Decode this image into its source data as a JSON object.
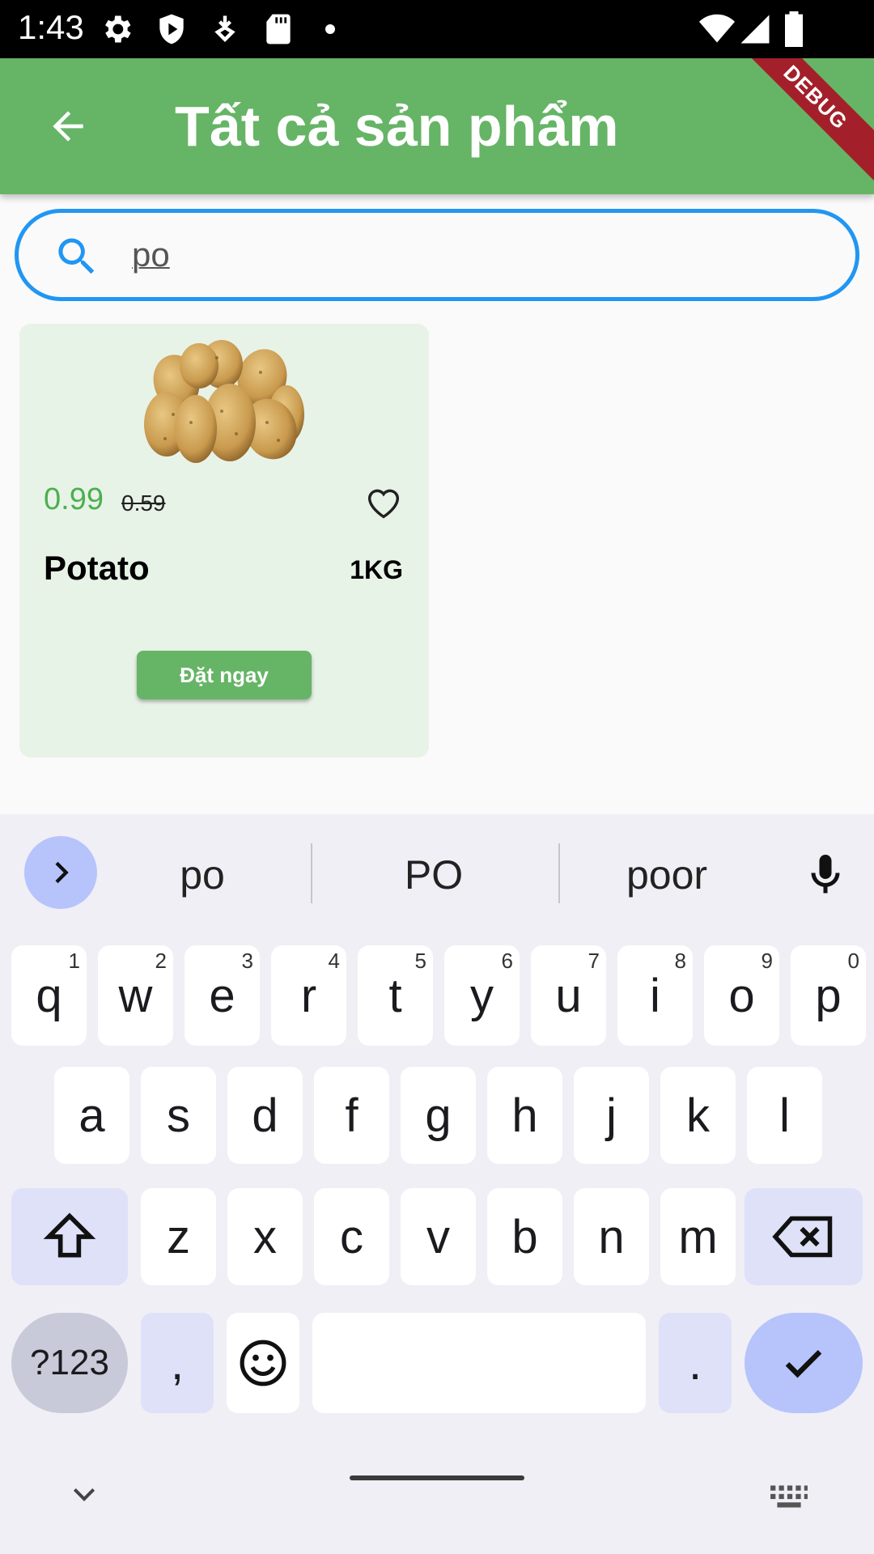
{
  "status_bar": {
    "time": "1:43"
  },
  "app_bar": {
    "title": "Tất cả sản phẩm",
    "debug_label": "DEBUG"
  },
  "search": {
    "value": "po"
  },
  "product": {
    "price_new": "0.99",
    "price_old": "0.59",
    "name": "Potato",
    "weight": "1KG",
    "order_label": "Đặt ngay"
  },
  "keyboard": {
    "suggestions": [
      "po",
      "PO",
      "poor"
    ],
    "row1": [
      {
        "k": "q",
        "n": "1"
      },
      {
        "k": "w",
        "n": "2"
      },
      {
        "k": "e",
        "n": "3"
      },
      {
        "k": "r",
        "n": "4"
      },
      {
        "k": "t",
        "n": "5"
      },
      {
        "k": "y",
        "n": "6"
      },
      {
        "k": "u",
        "n": "7"
      },
      {
        "k": "i",
        "n": "8"
      },
      {
        "k": "o",
        "n": "9"
      },
      {
        "k": "p",
        "n": "0"
      }
    ],
    "row2": [
      "a",
      "s",
      "d",
      "f",
      "g",
      "h",
      "j",
      "k",
      "l"
    ],
    "row3": [
      "z",
      "x",
      "c",
      "v",
      "b",
      "n",
      "m"
    ],
    "symbols_label": "?123",
    "comma_label": ",",
    "period_label": "."
  },
  "colors": {
    "app_bar": "#66b466",
    "search_border": "#2196f3",
    "price": "#4caf50",
    "card": "#e8f3e8"
  }
}
